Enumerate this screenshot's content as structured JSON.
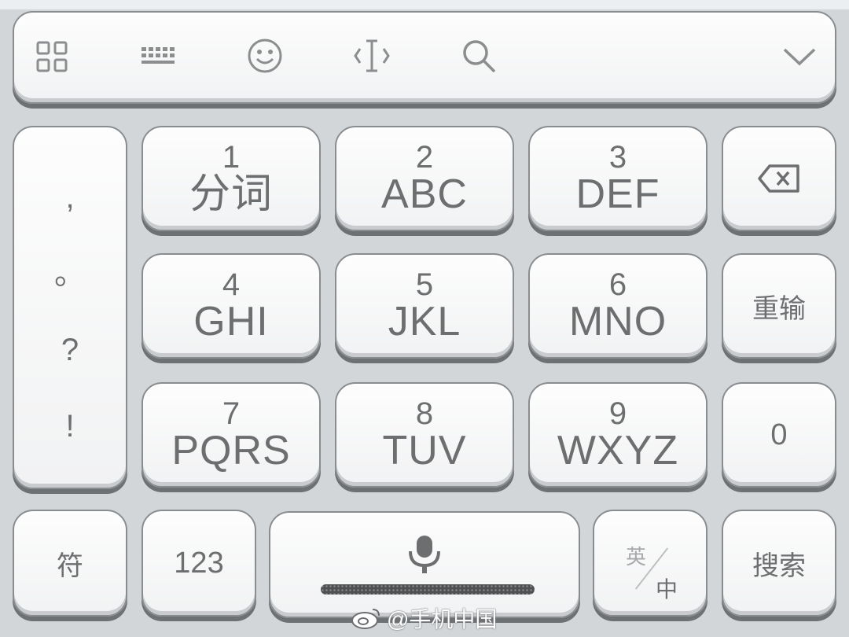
{
  "toolbar": {
    "icons": [
      "apps-grid-icon",
      "keyboard-icon",
      "emoji-icon",
      "cursor-move-icon",
      "search-icon",
      "collapse-chevron-icon"
    ]
  },
  "punctuation": [
    ",",
    "。",
    "?",
    "!"
  ],
  "keys": {
    "k1": {
      "num": "1",
      "letters": "分词"
    },
    "k2": {
      "num": "2",
      "letters": "ABC"
    },
    "k3": {
      "num": "3",
      "letters": "DEF"
    },
    "k4": {
      "num": "4",
      "letters": "GHI"
    },
    "k5": {
      "num": "5",
      "letters": "JKL"
    },
    "k6": {
      "num": "6",
      "letters": "MNO"
    },
    "k7": {
      "num": "7",
      "letters": "PQRS"
    },
    "k8": {
      "num": "8",
      "letters": "TUV"
    },
    "k9": {
      "num": "9",
      "letters": "WXYZ"
    }
  },
  "side": {
    "reenter": "重输",
    "zero": "0"
  },
  "bottom": {
    "symbol": "符",
    "numbers": "123",
    "lang_top": "英",
    "lang_bottom": "中",
    "search": "搜索"
  },
  "colors": {
    "background": "#d3d6d9",
    "key": "#f5f6f7",
    "text": "#6d6e70"
  },
  "watermark": "@手机中国"
}
